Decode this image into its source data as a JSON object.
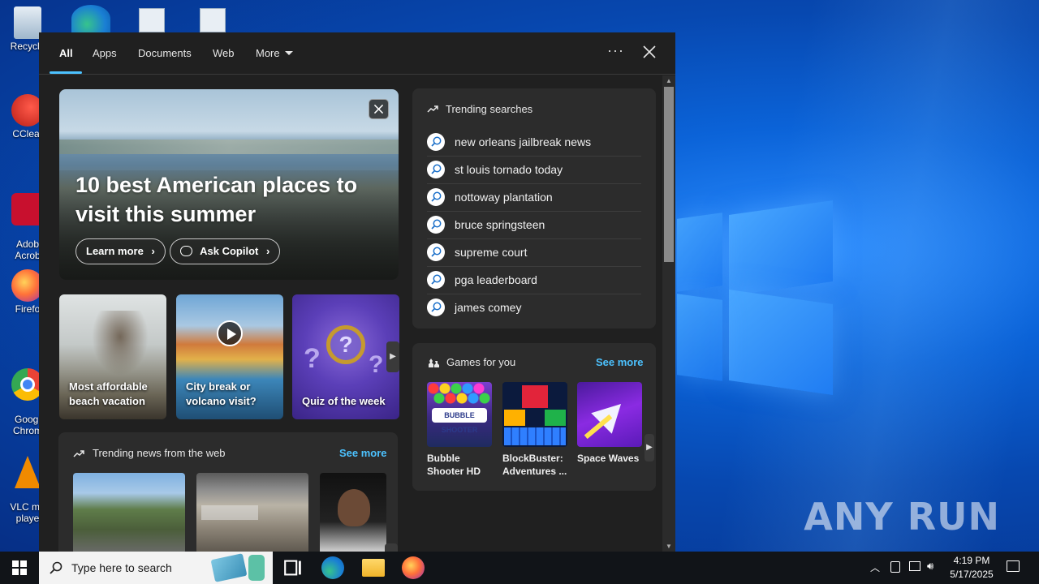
{
  "desktop": {
    "icons": [
      {
        "label": "Recycle",
        "color": "#9fb7cc"
      },
      {
        "label": "CClear",
        "color": "#d8342c"
      },
      {
        "label": "Adob\nAcrob",
        "color": "#c8102e"
      },
      {
        "label": "Firefo",
        "color": "#ff7139"
      },
      {
        "label": "Googl\nChrom",
        "color": "#34a853"
      },
      {
        "label": "VLC me\nplaye",
        "color": "#f08a00"
      }
    ],
    "watermark": "ANY RUN"
  },
  "search_panel": {
    "tabs": [
      {
        "label": "All",
        "active": true
      },
      {
        "label": "Apps"
      },
      {
        "label": "Documents"
      },
      {
        "label": "Web"
      },
      {
        "label": "More"
      }
    ],
    "more_options": "···",
    "hero": {
      "title": "10 best American places to visit this summer",
      "learn_more": "Learn more",
      "ask_copilot": "Ask Copilot"
    },
    "cards": [
      {
        "caption": "Most affordable beach vacation"
      },
      {
        "caption": "City break or volcano visit?"
      },
      {
        "caption": "Quiz of the week"
      }
    ],
    "trending_news": {
      "title": "Trending news from the web",
      "see_more": "See more"
    },
    "trending_searches": {
      "title": "Trending searches",
      "items": [
        "new orleans jailbreak news",
        "st louis tornado today",
        "nottoway plantation",
        "bruce springsteen",
        "supreme court",
        "pga leaderboard",
        "james comey"
      ]
    },
    "games": {
      "title": "Games for you",
      "see_more": "See more",
      "items": [
        {
          "name": "Bubble Shooter HD"
        },
        {
          "name": "BlockBuster: Adventures ..."
        },
        {
          "name": "Space Waves"
        }
      ]
    }
  },
  "taskbar": {
    "search_placeholder": "Type here to search",
    "time": "4:19 PM",
    "date": "5/17/2025"
  },
  "colors": {
    "accent": "#4cc2ff",
    "panel_bg": "#202020",
    "card_bg": "#2c2c2c"
  }
}
